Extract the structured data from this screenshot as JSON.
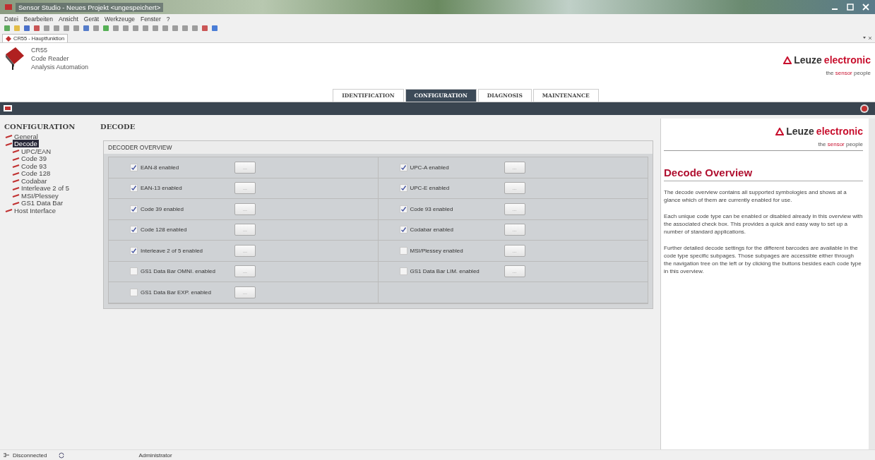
{
  "window": {
    "title": "Sensor Studio - Neues Projekt <ungespeichert>"
  },
  "menu": [
    "Datei",
    "Bearbeiten",
    "Ansicht",
    "Gerät",
    "Werkzeuge",
    "Fenster",
    "?"
  ],
  "document_tab": {
    "label": "CR55 - Hauptfunktion"
  },
  "device": {
    "model": "CR55",
    "type": "Code Reader",
    "vendor": "Analysis Automation"
  },
  "brand": {
    "name": "Leuze",
    "suffix": "electronic",
    "tagline_before": "the ",
    "tagline_highlight": "sensor",
    "tagline_after": " people"
  },
  "help_brand": {
    "name": "Leuze",
    "suffix": "electronic",
    "tagline_before": "the ",
    "tagline_highlight": "sensor",
    "tagline_after": " people"
  },
  "tabs": [
    {
      "label": "IDENTIFICATION",
      "selected": false
    },
    {
      "label": "CONFIGURATION",
      "selected": true
    },
    {
      "label": "DIAGNOSIS",
      "selected": false
    },
    {
      "label": "MAINTENANCE",
      "selected": false
    }
  ],
  "tree": {
    "title": "CONFIGURATION",
    "items": [
      {
        "label": "General",
        "selected": false
      },
      {
        "label": "Decode",
        "selected": true,
        "children": [
          {
            "label": "UPC/EAN",
            "selected": false
          },
          {
            "label": "Code 39",
            "selected": false
          },
          {
            "label": "Code 93",
            "selected": false
          },
          {
            "label": "Code 128",
            "selected": false
          },
          {
            "label": "Codabar",
            "selected": false
          },
          {
            "label": "Interleave 2 of 5",
            "selected": false
          },
          {
            "label": "MSI/Plessey",
            "selected": false
          },
          {
            "label": "GS1 Data Bar",
            "selected": false
          }
        ]
      },
      {
        "label": "Host Interface",
        "selected": false
      }
    ]
  },
  "content": {
    "title": "DECODE",
    "group_title": "DECODER OVERVIEW",
    "left": [
      {
        "label": "EAN-8 enabled",
        "checked": true,
        "button": "..."
      },
      {
        "label": "EAN-13 enabled",
        "checked": true,
        "button": "..."
      },
      {
        "label": "Code 39 enabled",
        "checked": true,
        "button": "..."
      },
      {
        "label": "Code 128 enabled",
        "checked": true,
        "button": "..."
      },
      {
        "label": "Interleave 2 of 5 enabled",
        "checked": true,
        "button": "..."
      },
      {
        "label": "GS1 Data Bar OMNI. enabled",
        "checked": false,
        "button": "..."
      },
      {
        "label": "GS1 Data Bar EXP. enabled",
        "checked": false,
        "button": "..."
      }
    ],
    "right": [
      {
        "label": "UPC-A enabled",
        "checked": true,
        "button": "..."
      },
      {
        "label": "UPC-E enabled",
        "checked": true,
        "button": "..."
      },
      {
        "label": "Code 93 enabled",
        "checked": true,
        "button": "..."
      },
      {
        "label": "Codabar enabled",
        "checked": true,
        "button": "..."
      },
      {
        "label": "MSI/Plessey enabled",
        "checked": false,
        "button": "..."
      },
      {
        "label": "GS1 Data Bar LIM. enabled",
        "checked": false,
        "button": "..."
      }
    ]
  },
  "help": {
    "title": "Decode Overview",
    "paragraphs": [
      "The decode overview contains all supported symbologies and shows at a glance which of them are currently enabled for use.",
      "Each unique code type can be enabled or disabled already in this overview with the associated check box. This provides a quick and easy way to set up a number of standard applications.",
      "Further detailed decode settings for the different barcodes are available in the code type specific subpages. Those subpages are accessible either through the navigation tree on the left or by clicking the buttons besides each code type in this overview."
    ]
  },
  "status_bar": {
    "connection": "Disconnected",
    "user": "Administrator"
  }
}
